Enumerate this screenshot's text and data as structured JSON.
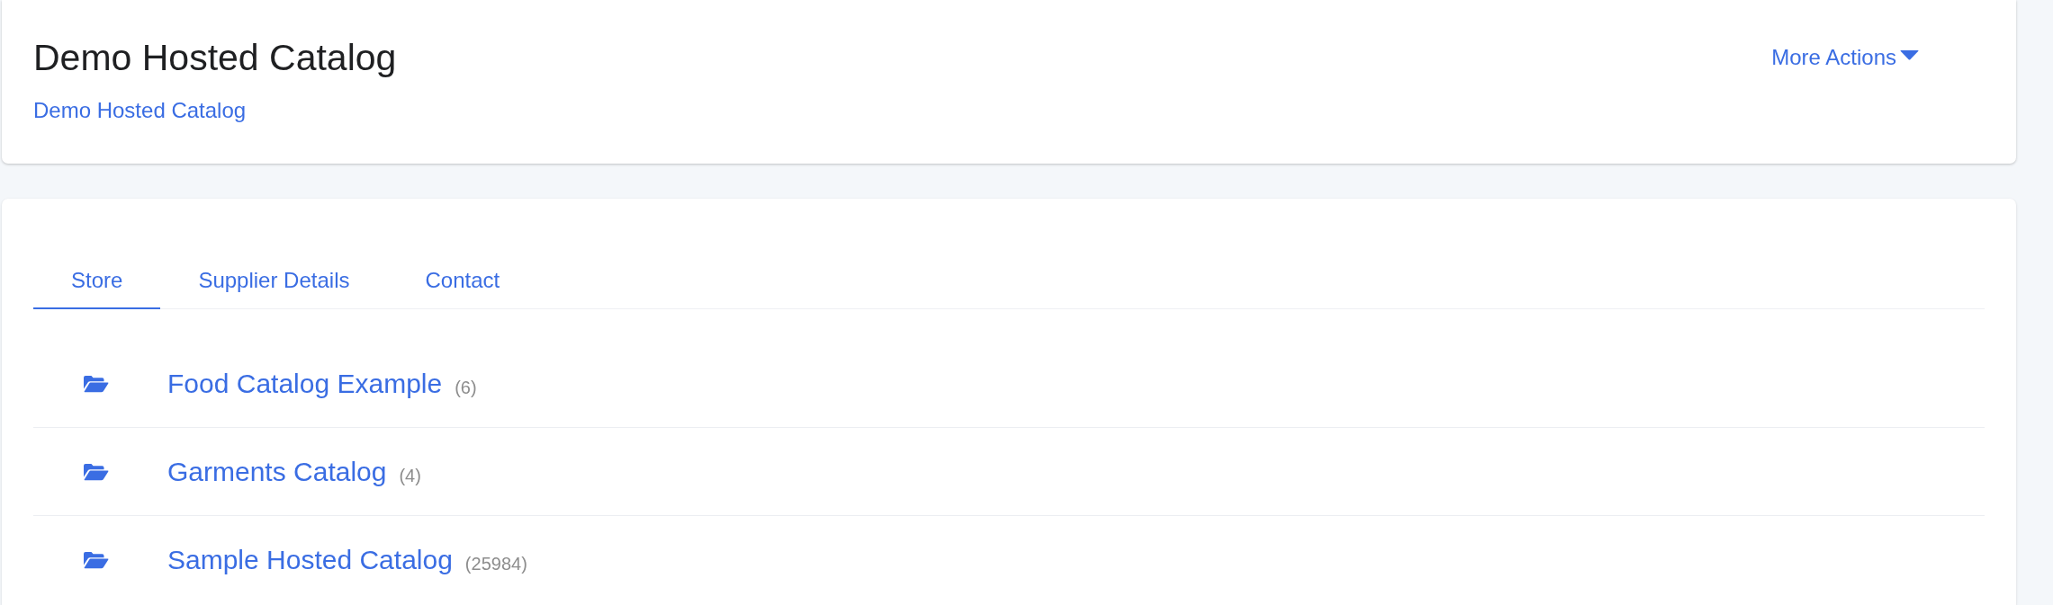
{
  "header": {
    "title": "Demo Hosted Catalog",
    "breadcrumb": "Demo Hosted Catalog",
    "actions_label": "More Actions"
  },
  "tabs": [
    {
      "label": "Store",
      "selected": true
    },
    {
      "label": "Supplier Details",
      "selected": false
    },
    {
      "label": "Contact",
      "selected": false
    }
  ],
  "catalogs": [
    {
      "name": "Food Catalog Example",
      "count": "(6)"
    },
    {
      "name": "Garments Catalog",
      "count": "(4)"
    },
    {
      "name": "Sample Hosted Catalog",
      "count": "(25984)"
    }
  ]
}
